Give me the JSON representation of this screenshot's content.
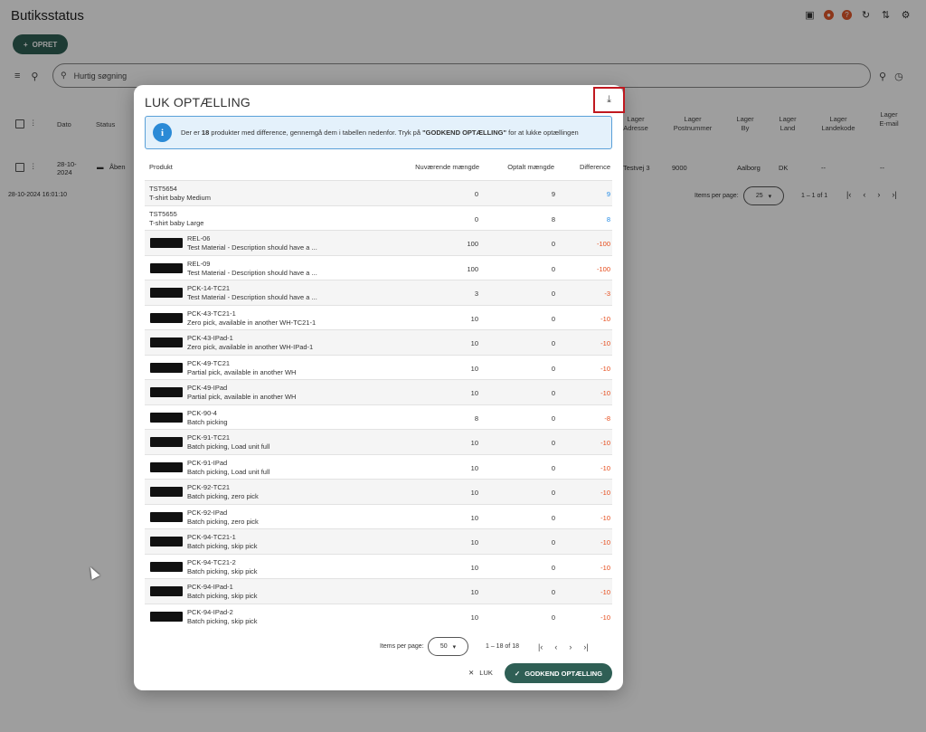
{
  "bg": {
    "title": "Butiksstatus",
    "opret": "OPRET",
    "search_placeholder": "Hurtig søgning",
    "headers": [
      "Dato",
      "Status",
      "Lager Adresse",
      "Lager Postnummer",
      "Lager By",
      "Lager Land",
      "Lager Landekode",
      "Lager E-mail"
    ],
    "row": {
      "date": "28-10-2024",
      "status": "Åben",
      "address": "Testvej 3",
      "postal": "9000",
      "city": "Aalborg",
      "country": "DK",
      "code": "--",
      "email": "--"
    },
    "timestamp": "28-10-2024 16:01:10",
    "items_per_page_label": "Items per page:",
    "items_per_page": "25",
    "range": "1 – 1 of 1"
  },
  "modal": {
    "title": "LUK OPTÆLLING",
    "info_pre": "Der er ",
    "info_count": "18",
    "info_mid": " produkter med difference, gennemgå dem i tabellen nedenfor. Tryk på ",
    "info_button_ref": "\"GODKEND OPTÆLLING\"",
    "info_post": " for at lukke optællingen",
    "columns": {
      "product": "Produkt",
      "current": "Nuværende mængde",
      "counted": "Optalt mængde",
      "difference": "Difference"
    },
    "rows": [
      {
        "sku": "TST5654",
        "desc": "T-shirt baby Medium",
        "current": "0",
        "counted": "9",
        "diff": "9",
        "thumb": false
      },
      {
        "sku": "TST5655",
        "desc": "T-shirt baby Large",
        "current": "0",
        "counted": "8",
        "diff": "8",
        "thumb": false
      },
      {
        "sku": "REL-06",
        "desc": "Test Material - Description should have a ...",
        "current": "100",
        "counted": "0",
        "diff": "-100",
        "thumb": true
      },
      {
        "sku": "REL-09",
        "desc": "Test Material - Description should have a ...",
        "current": "100",
        "counted": "0",
        "diff": "-100",
        "thumb": true
      },
      {
        "sku": "PCK-14-TC21",
        "desc": "Test Material - Description should have a ...",
        "current": "3",
        "counted": "0",
        "diff": "-3",
        "thumb": true
      },
      {
        "sku": "PCK-43-TC21-1",
        "desc": "Zero pick, available in another WH-TC21-1",
        "current": "10",
        "counted": "0",
        "diff": "-10",
        "thumb": true
      },
      {
        "sku": "PCK-43-IPad-1",
        "desc": "Zero pick, available in another WH-IPad-1",
        "current": "10",
        "counted": "0",
        "diff": "-10",
        "thumb": true
      },
      {
        "sku": "PCK-49-TC21",
        "desc": "Partial pick, available in another WH",
        "current": "10",
        "counted": "0",
        "diff": "-10",
        "thumb": true
      },
      {
        "sku": "PCK-49-IPad",
        "desc": "Partial pick, available in another WH",
        "current": "10",
        "counted": "0",
        "diff": "-10",
        "thumb": true
      },
      {
        "sku": "PCK-90-4",
        "desc": "Batch picking",
        "current": "8",
        "counted": "0",
        "diff": "-8",
        "thumb": true
      },
      {
        "sku": "PCK-91-TC21",
        "desc": "Batch picking, Load unit full",
        "current": "10",
        "counted": "0",
        "diff": "-10",
        "thumb": true
      },
      {
        "sku": "PCK-91-IPad",
        "desc": "Batch picking, Load unit full",
        "current": "10",
        "counted": "0",
        "diff": "-10",
        "thumb": true
      },
      {
        "sku": "PCK-92-TC21",
        "desc": "Batch picking, zero pick",
        "current": "10",
        "counted": "0",
        "diff": "-10",
        "thumb": true
      },
      {
        "sku": "PCK-92-IPad",
        "desc": "Batch picking, zero pick",
        "current": "10",
        "counted": "0",
        "diff": "-10",
        "thumb": true
      },
      {
        "sku": "PCK-94-TC21-1",
        "desc": "Batch picking, skip pick",
        "current": "10",
        "counted": "0",
        "diff": "-10",
        "thumb": true
      },
      {
        "sku": "PCK-94-TC21-2",
        "desc": "Batch picking, skip pick",
        "current": "10",
        "counted": "0",
        "diff": "-10",
        "thumb": true
      },
      {
        "sku": "PCK-94-IPad-1",
        "desc": "Batch picking, skip pick",
        "current": "10",
        "counted": "0",
        "diff": "-10",
        "thumb": true
      },
      {
        "sku": "PCK-94-IPad-2",
        "desc": "Batch picking, skip pick",
        "current": "10",
        "counted": "0",
        "diff": "-10",
        "thumb": true
      }
    ],
    "items_per_page_label": "Items per page:",
    "items_per_page": "50",
    "range": "1 – 18 of 18",
    "luk_label": "LUK",
    "godkend_label": "GODKEND OPTÆLLING"
  },
  "colors": {
    "accent": "#2f5f55",
    "positive": "#1e88e5",
    "negative": "#e64a19",
    "info_bg": "#e4f1fb",
    "highlight": "#c0181f"
  }
}
